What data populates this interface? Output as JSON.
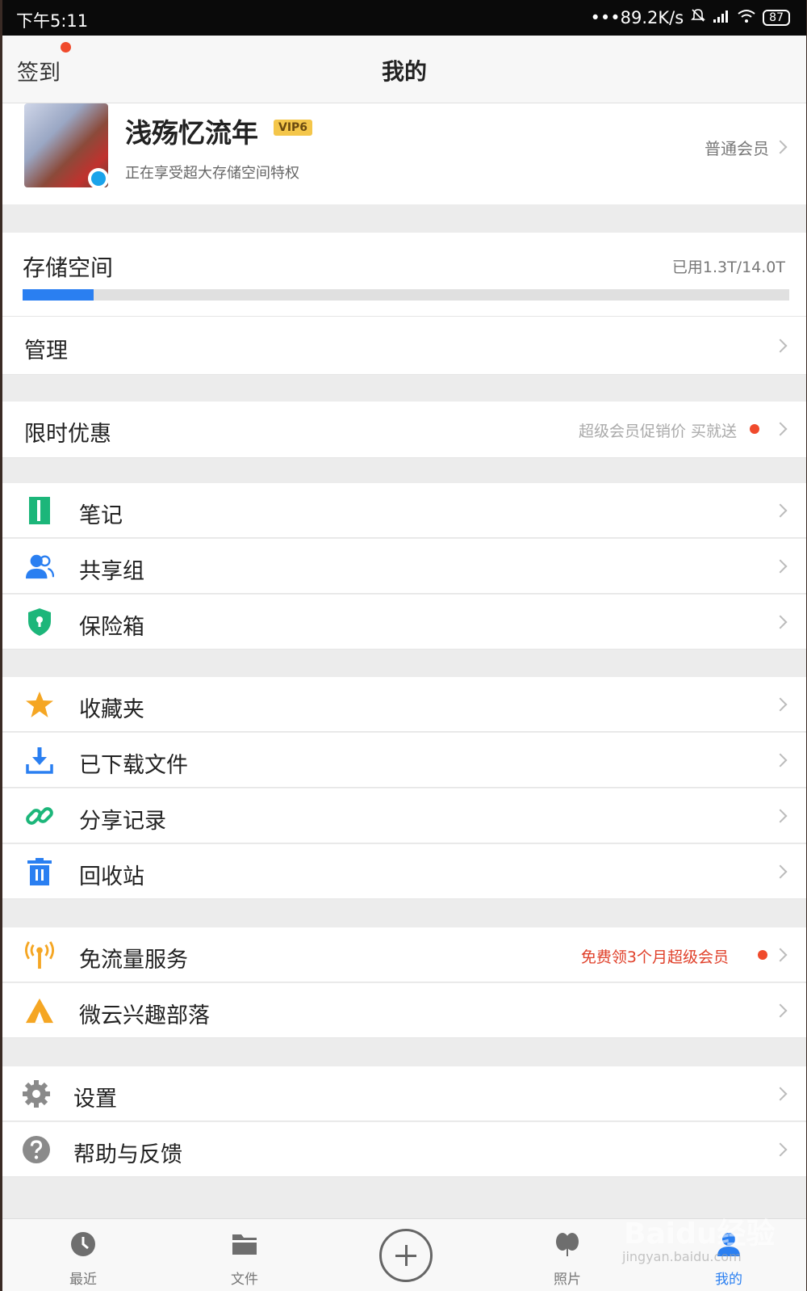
{
  "status_bar": {
    "time": "下午5:11",
    "speed": "•••89.2K/s",
    "battery": "87"
  },
  "header": {
    "checkin": "签到",
    "title": "我的"
  },
  "profile": {
    "name": "浅殇忆流年",
    "vip_badge": "VIP6",
    "subtitle": "正在享受超大存储空间特权",
    "membership": "普通会员"
  },
  "storage": {
    "label": "存储空间",
    "used_text": "已用1.3T/14.0T",
    "used_fraction": 0.093,
    "bar_color": "#2a7ff1"
  },
  "manage": {
    "label": "管理"
  },
  "promo": {
    "label": "限时优惠",
    "note": "超级会员促销价 买就送"
  },
  "tools": [
    {
      "label": "笔记",
      "icon": "note-icon"
    },
    {
      "label": "共享组",
      "icon": "group-icon"
    },
    {
      "label": "保险箱",
      "icon": "safe-icon"
    }
  ],
  "files": [
    {
      "label": "收藏夹",
      "icon": "star-icon"
    },
    {
      "label": "已下载文件",
      "icon": "download-icon"
    },
    {
      "label": "分享记录",
      "icon": "link-icon"
    },
    {
      "label": "回收站",
      "icon": "trash-icon"
    }
  ],
  "services": [
    {
      "label": "免流量服务",
      "icon": "antenna-icon",
      "note": "免费领3个月超级会员"
    },
    {
      "label": "微云兴趣部落",
      "icon": "tent-icon"
    }
  ],
  "settings": [
    {
      "label": "设置",
      "icon": "gear-icon"
    },
    {
      "label": "帮助与反馈",
      "icon": "help-icon"
    }
  ],
  "tabs": [
    {
      "label": "最近",
      "icon": "clock-icon"
    },
    {
      "label": "文件",
      "icon": "folder-icon"
    },
    {
      "label": "照片",
      "icon": "photo-icon"
    },
    {
      "label": "我的",
      "icon": "person-icon",
      "active": true
    }
  ],
  "watermark": {
    "brand": "Baidu经验",
    "url": "jingyan.baidu.com"
  },
  "colors": {
    "accent": "#2a7ff1",
    "red": "#f04a2c",
    "green": "#1cb67a",
    "orange": "#f5a623"
  }
}
